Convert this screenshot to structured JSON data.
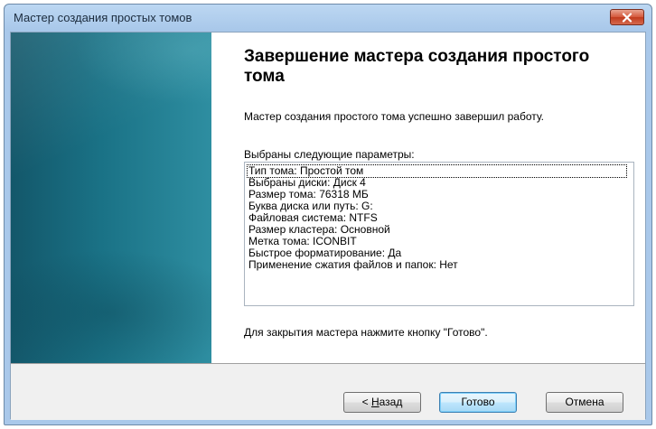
{
  "window": {
    "title": "Мастер создания простых томов",
    "close_icon": "close-icon"
  },
  "page": {
    "heading": "Завершение мастера создания простого тома",
    "description": "Мастер создания простого тома успешно завершил работу.",
    "params_label": "Выбраны следующие параметры:",
    "params": [
      "Тип тома: Простой том",
      "Выбраны диски: Диск 4",
      "Размер тома: 76318 МБ",
      "Буква диска или путь: G:",
      "Файловая система: NTFS",
      "Размер кластера: Основной",
      "Метка тома: ICONBIT",
      "Быстрое форматирование: Да",
      "Применение сжатия файлов и папок: Нет"
    ],
    "finish_note": "Для закрытия мастера нажмите кнопку \"Готово\"."
  },
  "buttons": {
    "back_prefix": "< ",
    "back_mnemonic": "Н",
    "back_rest": "азад",
    "finish": "Готово",
    "cancel": "Отмена"
  },
  "colors": {
    "banner": "#1a7286",
    "titlebar": "#bcd7f2",
    "close": "#c13b1e"
  }
}
